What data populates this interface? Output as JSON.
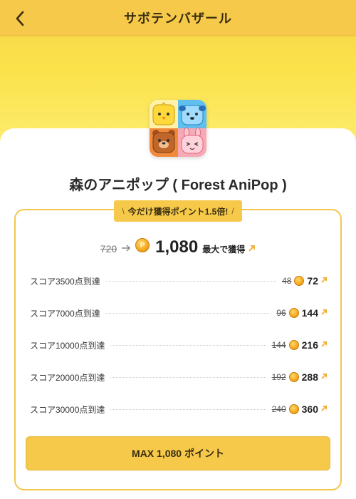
{
  "header": {
    "title": "サボテンバザール"
  },
  "game": {
    "title": "森のアニポップ ( Forest AniPop )"
  },
  "promo": {
    "badge": "今だけ獲得ポイント1.5倍!",
    "slash_left": "\\",
    "slash_right": "/"
  },
  "total": {
    "old": "720",
    "new": "1,080",
    "suffix": "最大で獲得"
  },
  "missions": [
    {
      "label": "スコア3500点到達",
      "old": "48",
      "new": "72"
    },
    {
      "label": "スコア7000点到達",
      "old": "96",
      "new": "144"
    },
    {
      "label": "スコア10000点到達",
      "old": "144",
      "new": "216"
    },
    {
      "label": "スコア20000点到達",
      "old": "192",
      "new": "288"
    },
    {
      "label": "スコア30000点到達",
      "old": "240",
      "new": "360"
    }
  ],
  "cta": {
    "label": "MAX 1,080 ポイント"
  },
  "colors": {
    "accent": "#f6c94a",
    "coin": "#f4a820",
    "arrow": "#f0a92c"
  }
}
